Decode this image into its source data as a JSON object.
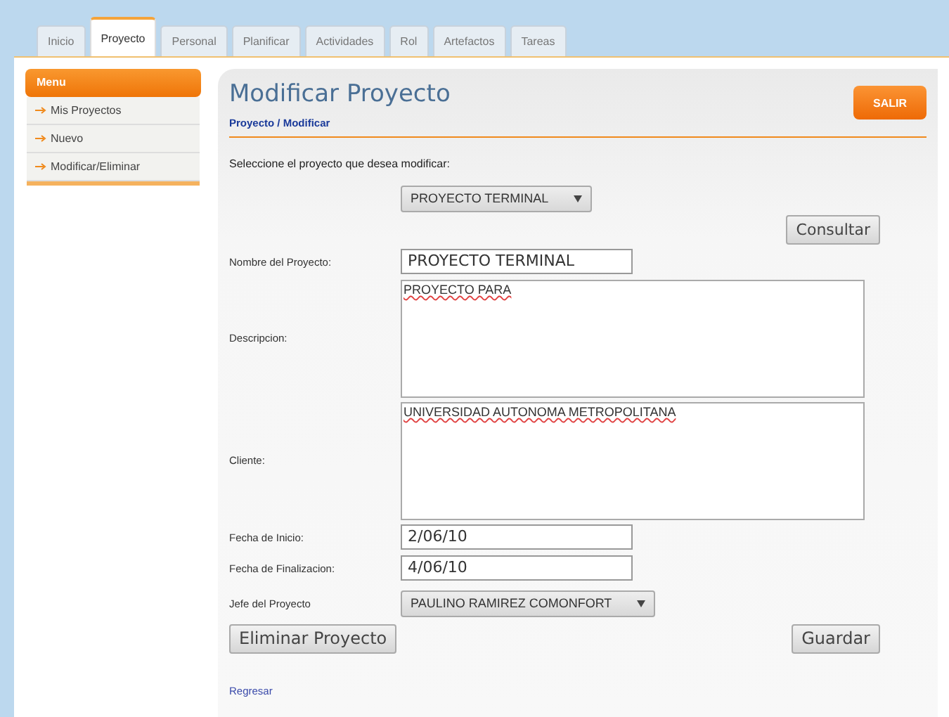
{
  "tabs": [
    {
      "label": "Inicio",
      "selected": false
    },
    {
      "label": "Proyecto",
      "selected": true
    },
    {
      "label": "Personal",
      "selected": false
    },
    {
      "label": "Planificar",
      "selected": false
    },
    {
      "label": "Actividades",
      "selected": false
    },
    {
      "label": "Rol",
      "selected": false
    },
    {
      "label": "Artefactos",
      "selected": false
    },
    {
      "label": "Tareas",
      "selected": false
    }
  ],
  "sidebar": {
    "title": "Menu",
    "items": [
      "Mis Proyectos",
      "Nuevo",
      "Modificar/Eliminar"
    ]
  },
  "header": {
    "title": "Modificar Proyecto",
    "breadcrumb": "Proyecto / Modificar",
    "exit_button": "SALIR"
  },
  "form": {
    "prompt": "Seleccione el proyecto que desea modificar:",
    "project_select": "PROYECTO TERMINAL",
    "query_button": "Consultar",
    "fields": [
      {
        "kind": "input",
        "label": "Nombre del Proyecto:",
        "value": "PROYECTO TERMINAL"
      },
      {
        "kind": "textarea",
        "label": "Descripcion:",
        "value": "PROYECTO PARA"
      },
      {
        "kind": "textarea",
        "label": "Cliente:",
        "value": "UNIVERSIDAD AUTONOMA METROPOLITANA"
      },
      {
        "kind": "input",
        "label": "Fecha de Inicio:",
        "value": "2/06/10"
      },
      {
        "kind": "input",
        "label": "Fecha de Finalizacion:",
        "value": "4/06/10"
      },
      {
        "kind": "select",
        "label": "Jefe del Proyecto",
        "value": "PAULINO RAMIREZ COMONFORT"
      }
    ],
    "delete_button": "Eliminar Proyecto",
    "save_button": "Guardar",
    "back_link": "Regresar"
  }
}
